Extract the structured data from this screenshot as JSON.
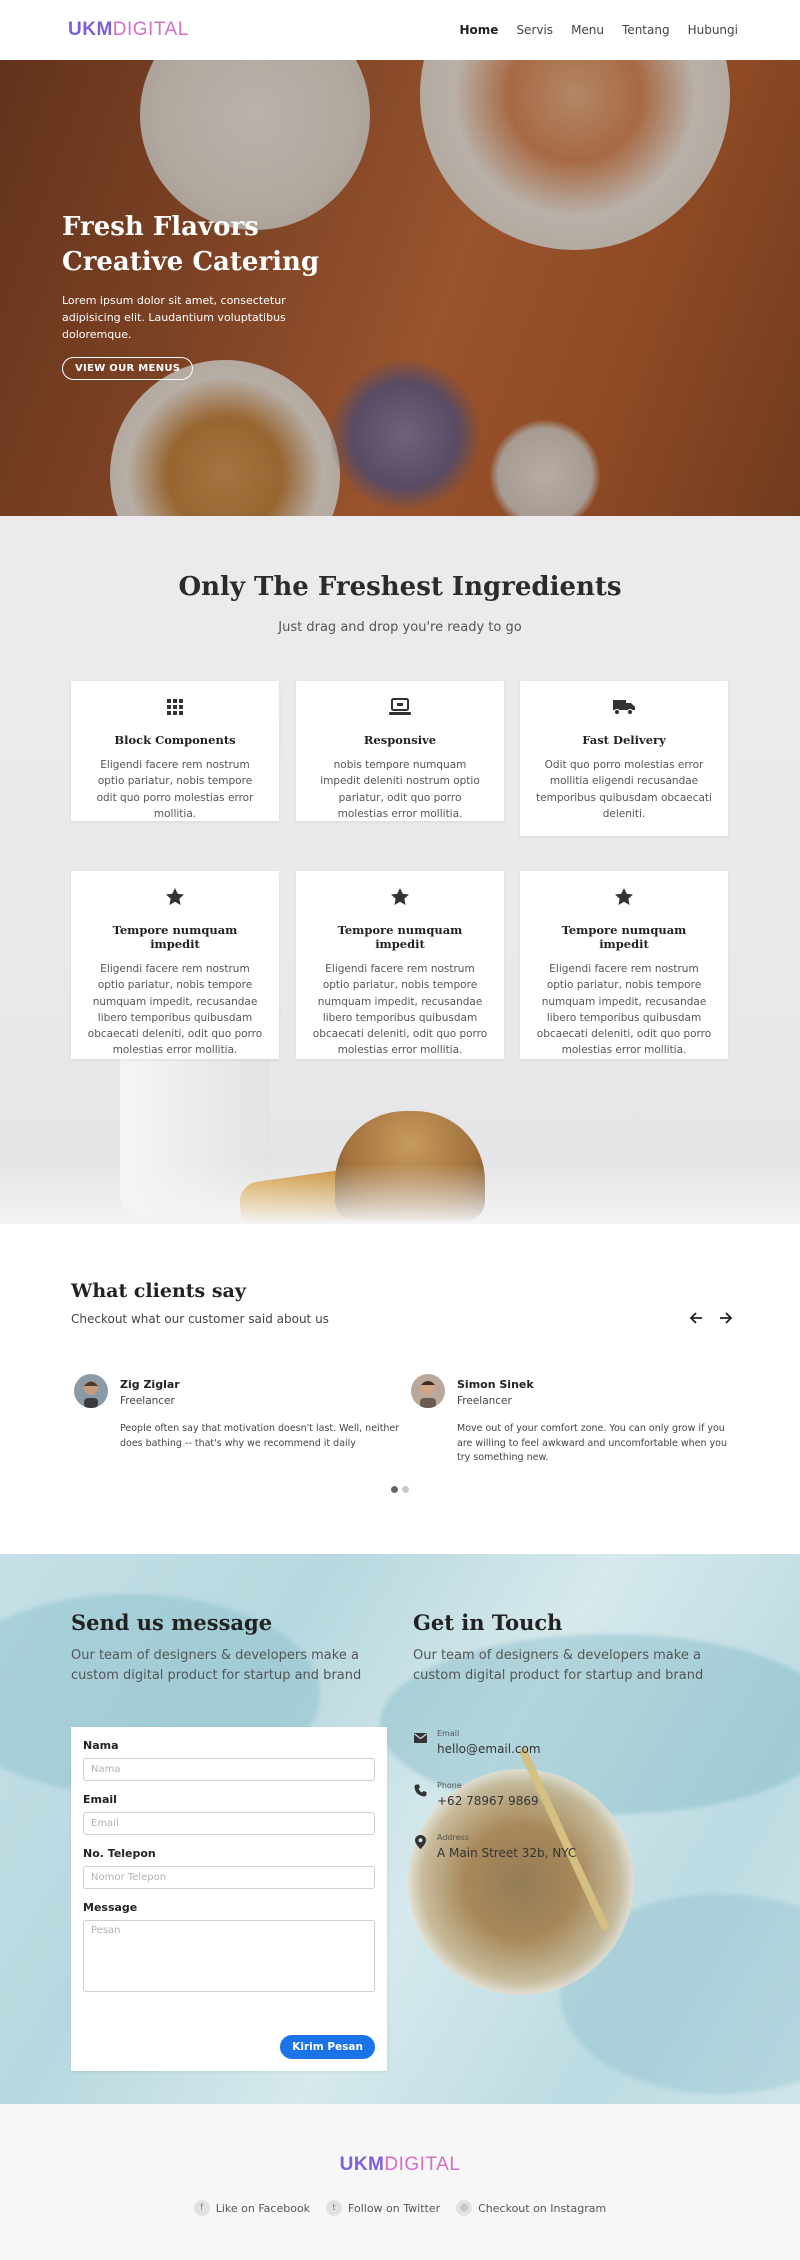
{
  "brand": {
    "part1": "UKM",
    "part2": "DIGITAL"
  },
  "nav": {
    "items": [
      {
        "label": "Home",
        "active": true
      },
      {
        "label": "Servis",
        "active": false
      },
      {
        "label": "Menu",
        "active": false
      },
      {
        "label": "Tentang",
        "active": false
      },
      {
        "label": "Hubungi",
        "active": false
      }
    ]
  },
  "hero": {
    "title_line1": "Fresh Flavors",
    "title_line2": "Creative Catering",
    "text": "Lorem ipsum dolor sit amet, consectetur adipisicing elit. Laudantium voluptatibus doloremque.",
    "button": "VIEW OUR MENUS"
  },
  "features": {
    "title": "Only The Freshest Ingredients",
    "subtitle": "Just drag and drop you're ready to go",
    "cards": [
      {
        "icon": "grid-icon",
        "title": "Block Components",
        "text": "Eligendi facere rem nostrum optio pariatur, nobis tempore odit quo porro molestias error mollitia."
      },
      {
        "icon": "laptop-icon",
        "title": "Responsive",
        "text": "nobis tempore numquam impedit deleniti nostrum optio pariatur, odit quo porro molestias error mollitia."
      },
      {
        "icon": "truck-icon",
        "title": "Fast Delivery",
        "text": "Odit quo porro molestias error mollitia eligendi recusandae temporibus quibusdam obcaecati deleniti."
      },
      {
        "icon": "star-icon",
        "title": "Tempore numquam impedit",
        "text": "Eligendi facere rem nostrum optio pariatur, nobis tempore numquam impedit, recusandae libero temporibus quibusdam obcaecati deleniti, odit quo porro molestias error mollitia."
      },
      {
        "icon": "star-icon",
        "title": "Tempore numquam impedit",
        "text": "Eligendi facere rem nostrum optio pariatur, nobis tempore numquam impedit, recusandae libero temporibus quibusdam obcaecati deleniti, odit quo porro molestias error mollitia."
      },
      {
        "icon": "star-icon",
        "title": "Tempore numquam impedit",
        "text": "Eligendi facere rem nostrum optio pariatur, nobis tempore numquam impedit, recusandae libero temporibus quibusdam obcaecati deleniti, odit quo porro molestias error mollitia."
      }
    ]
  },
  "testimonials": {
    "title": "What clients say",
    "subtitle": "Checkout what our customer said about us",
    "items": [
      {
        "name": "Zig Ziglar",
        "role": "Freelancer",
        "text": "People often say that motivation doesn't last. Well, neither does bathing -- that's why we recommend it daily"
      },
      {
        "name": "Simon Sinek",
        "role": "Freelancer",
        "text": "Move out of your comfort zone. You can only grow if you are willing to feel awkward and uncomfortable when you try something new."
      }
    ]
  },
  "contact": {
    "send_title": "Send us message",
    "send_sub": "Our team of designers & developers make a custom digital product for startup and brand",
    "touch_title": "Get in Touch",
    "touch_sub": "Our team of designers & developers make a custom digital product for startup and brand",
    "form": {
      "nama_label": "Nama",
      "nama_placeholder": "Nama",
      "email_label": "Email",
      "email_placeholder": "Email",
      "phone_label": "No. Telepon",
      "phone_placeholder": "Nomor Telepon",
      "message_label": "Message",
      "message_placeholder": "Pesan",
      "submit": "Kirim Pesan"
    },
    "info": [
      {
        "icon": "envelope-icon",
        "label": "Email",
        "value": "hello@email.com"
      },
      {
        "icon": "phone-icon",
        "label": "Phone",
        "value": "+62 78967 9869"
      },
      {
        "icon": "map-marker-icon",
        "label": "Address",
        "value": "A Main Street 32b, NYC"
      }
    ]
  },
  "footer": {
    "social": [
      {
        "icon": "facebook-icon",
        "label": "Like on Facebook"
      },
      {
        "icon": "twitter-icon",
        "label": "Follow on Twitter"
      },
      {
        "icon": "instagram-icon",
        "label": "Checkout on Instagram"
      }
    ]
  }
}
